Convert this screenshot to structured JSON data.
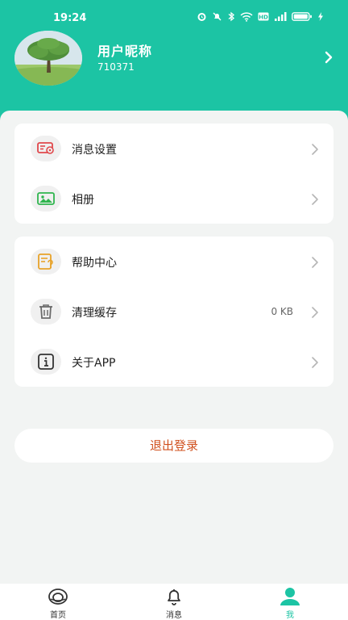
{
  "status": {
    "time": "19:24",
    "icons": [
      "alarm-icon",
      "bell-off-icon",
      "bluetooth-icon",
      "wifi-icon",
      "hd-icon",
      "signal-icon",
      "battery-icon",
      "charging-icon"
    ]
  },
  "profile": {
    "nickname": "用户昵称",
    "user_id": "710371"
  },
  "menu_group_1": [
    {
      "label": "消息设置",
      "icon": "message-settings-icon"
    },
    {
      "label": "相册",
      "icon": "album-icon"
    }
  ],
  "menu_group_2": [
    {
      "label": "帮助中心",
      "icon": "help-center-icon"
    },
    {
      "label": "清理缓存",
      "icon": "trash-icon",
      "value": "0 KB"
    },
    {
      "label": "关于APP",
      "icon": "info-icon"
    }
  ],
  "logout_label": "退出登录",
  "tabs": [
    {
      "label": "首页",
      "icon": "home-icon",
      "active": false
    },
    {
      "label": "消息",
      "icon": "bell-icon",
      "active": false
    },
    {
      "label": "我",
      "icon": "person-icon",
      "active": true
    }
  ],
  "colors": {
    "accent": "#1cc4a4",
    "logout_text": "#d0501e",
    "background": "#f2f4f3"
  }
}
